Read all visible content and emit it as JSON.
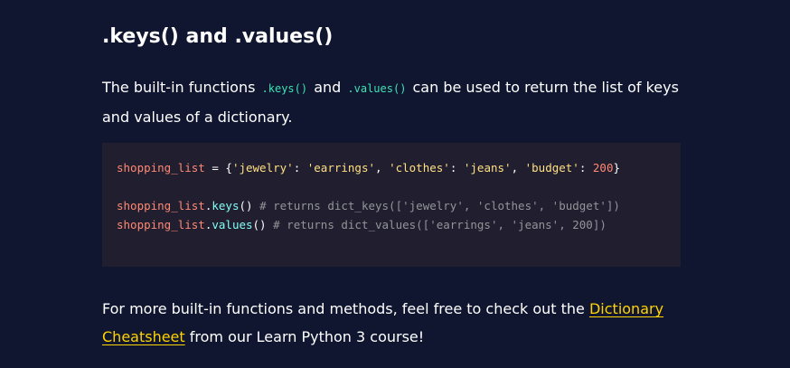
{
  "heading": ".keys() and .values()",
  "para1": {
    "text_a": "The built-in functions ",
    "code_keys": ".keys()",
    "text_b": " and ",
    "code_values": ".values()",
    "text_c": " can be used to return the list of keys and values of a dictionary."
  },
  "code": {
    "line1": {
      "var": "shopping_list",
      "op": " = {",
      "k1": "'jewelry'",
      "sep1": ": ",
      "v1": "'earrings'",
      "c1": ", ",
      "k2": "'clothes'",
      "sep2": ": ",
      "v2": "'jeans'",
      "c2": ", ",
      "k3": "'budget'",
      "sep3": ": ",
      "v3": "200",
      "close": "}"
    },
    "line3": {
      "var": "shopping_list",
      "dot": ".",
      "method": "keys",
      "paren": "()",
      "comment": " # returns dict_keys(['jewelry', 'clothes', 'budget'])"
    },
    "line4": {
      "var": "shopping_list",
      "dot": ".",
      "method": "values",
      "paren": "()",
      "comment": " # returns dict_values(['earrings', 'jeans', 200])"
    }
  },
  "para2": {
    "text_a": "For more built-in functions and methods, feel free to check out the ",
    "link": "Dictionary Cheatsheet",
    "text_b": " from our Learn Python 3 course!"
  }
}
